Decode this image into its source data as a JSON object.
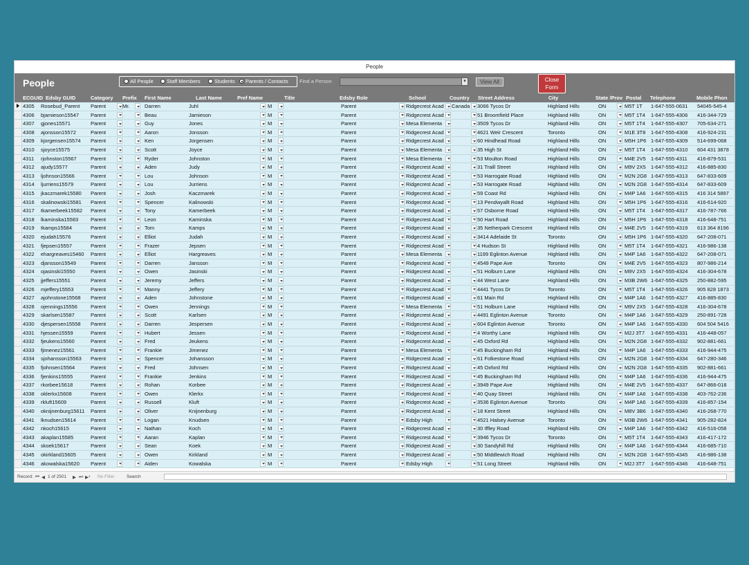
{
  "window": {
    "title": "People"
  },
  "form": {
    "title": "People"
  },
  "filter": {
    "options": [
      {
        "label": "All People",
        "selected": false
      },
      {
        "label": "Staff Members",
        "selected": false
      },
      {
        "label": "Students",
        "selected": false
      },
      {
        "label": "Parents / Contacts",
        "selected": true
      }
    ]
  },
  "find": {
    "label": "Find a Person",
    "value": ""
  },
  "buttons": {
    "view_all": "View All",
    "close_form": "Close Form"
  },
  "columns": [
    "ECGUID",
    "Edsby GUID",
    "Category",
    "Prefix",
    "First Name",
    "Last Name",
    "Pref Name",
    "Title",
    "Edsby Role",
    "School",
    "Country",
    "Street Address",
    "City",
    "State /Prov",
    "Postal",
    "Telephone",
    "Mobile Phon"
  ],
  "rows": [
    {
      "id": "4305",
      "guid": "Rosebud_Parent",
      "cat": "Parent",
      "prefix": "Mr.",
      "first": "Darren",
      "last": "Juhl",
      "g": "M",
      "role": "Parent",
      "school": "Ridgecrest Acad",
      "country": "Canada",
      "street": "3066 Tycos Dr",
      "city": "Highland Hills",
      "prov": "ON",
      "postal": "M5T 1T",
      "tel": "1-647-555-0631",
      "mobile": "54045-545-4"
    },
    {
      "id": "4306",
      "guid": "bjamieson15547",
      "cat": "Parent",
      "prefix": "",
      "first": "Beau",
      "last": "Jamieson",
      "g": "M",
      "role": "Parent",
      "school": "Ridgecrest Acad",
      "country": "",
      "street": "51 Broomfield Place",
      "city": "Highland Hills",
      "prov": "ON",
      "postal": "M5T 1T4",
      "tel": "1-647-555-4306",
      "mobile": "416-344-729"
    },
    {
      "id": "4307",
      "guid": "gjones15571",
      "cat": "Parent",
      "prefix": "",
      "first": "Guy",
      "last": "Jones",
      "g": "M",
      "role": "Parent",
      "school": "Mesa Elementa",
      "country": "",
      "street": "3509 Tycos Dr",
      "city": "Highland Hills",
      "prov": "ON",
      "postal": "M5T 1T4",
      "tel": "1-647-555-4307",
      "mobile": "705-634-271"
    },
    {
      "id": "4308",
      "guid": "ajonsson15572",
      "cat": "Parent",
      "prefix": "",
      "first": "Aaron",
      "last": "Jonsson",
      "g": "M",
      "role": "Parent",
      "school": "Ridgecrest Acad",
      "country": "",
      "street": "4621 Weir Crescent",
      "city": "Toronto",
      "prov": "ON",
      "postal": "M1E 3T8",
      "tel": "1-647-555-4308",
      "mobile": "416-924-231"
    },
    {
      "id": "4309",
      "guid": "kjorgensen15574",
      "cat": "Parent",
      "prefix": "",
      "first": "Ken",
      "last": "Jorgensen",
      "g": "M",
      "role": "Parent",
      "school": "Ridgecrest Acad",
      "country": "",
      "street": "60 Hindhead Road",
      "city": "Highland Hills",
      "prov": "ON",
      "postal": "M5H 1P6",
      "tel": "1-647-555-4309",
      "mobile": "514-699-068"
    },
    {
      "id": "4310",
      "guid": "sjoyce15575",
      "cat": "Parent",
      "prefix": "",
      "first": "Scott",
      "last": "Joyce",
      "g": "M",
      "role": "Parent",
      "school": "Mesa Elementa",
      "country": "",
      "street": "35 High St",
      "city": "Highland Hills",
      "prov": "ON",
      "postal": "M5T 1T4",
      "tel": "1-647-555-4310",
      "mobile": "604 431 3878"
    },
    {
      "id": "4311",
      "guid": "rjohnston15567",
      "cat": "Parent",
      "prefix": "",
      "first": "Ryder",
      "last": "Johnston",
      "g": "M",
      "role": "Parent",
      "school": "Mesa Elementa",
      "country": "",
      "street": "53 Moulton Road",
      "city": "Highland Hills",
      "prov": "ON",
      "postal": "M4E 2V5",
      "tel": "1-647-555-4311",
      "mobile": "416-879-531"
    },
    {
      "id": "4312",
      "guid": "ajudy15577",
      "cat": "Parent",
      "prefix": "",
      "first": "Aden",
      "last": "Judy",
      "g": "M",
      "role": "Parent",
      "school": "Ridgecrest Acad",
      "country": "",
      "street": "31 Traill Street",
      "city": "Highland Hills",
      "prov": "ON",
      "postal": "M9V 2X5",
      "tel": "1-647-555-4312",
      "mobile": "416-885-830"
    },
    {
      "id": "4313",
      "guid": "ljohnson15566",
      "cat": "Parent",
      "prefix": "",
      "first": "Lou",
      "last": "Johnson",
      "g": "M",
      "role": "Parent",
      "school": "Ridgecrest Acad",
      "country": "",
      "street": "53 Harrogate Road",
      "city": "Highland Hills",
      "prov": "ON",
      "postal": "M2N 2G8",
      "tel": "1-647-555-4313",
      "mobile": "647-833-609"
    },
    {
      "id": "4314",
      "guid": "ljurriens15579",
      "cat": "Parent",
      "prefix": "",
      "first": "Lou",
      "last": "Jurriens",
      "g": "M",
      "role": "Parent",
      "school": "Ridgecrest Acad",
      "country": "",
      "street": "53 Harrogate Road",
      "city": "Highland Hills",
      "prov": "ON",
      "postal": "M2N 2G8",
      "tel": "1-647-555-4314",
      "mobile": "647-833-609"
    },
    {
      "id": "4315",
      "guid": "jkaczmarek15580",
      "cat": "Parent",
      "prefix": "",
      "first": "Josh",
      "last": "Kaczmarek",
      "g": "M",
      "role": "Parent",
      "school": "Ridgecrest Acad",
      "country": "",
      "street": "59 Coast Rd",
      "city": "Highland Hills",
      "prov": "ON",
      "postal": "M4P 1A6",
      "tel": "1-647-555-4315",
      "mobile": "416 314 5897"
    },
    {
      "id": "4316",
      "guid": "skalinowski15581",
      "cat": "Parent",
      "prefix": "",
      "first": "Spencer",
      "last": "Kalinowski",
      "g": "M",
      "role": "Parent",
      "school": "Ridgecrest Acad",
      "country": "",
      "street": "13 Pendwyallt Road",
      "city": "Highland Hills",
      "prov": "ON",
      "postal": "M5H 1P6",
      "tel": "1-647-555-4316",
      "mobile": "416-614-920"
    },
    {
      "id": "4317",
      "guid": "tkamerbeek15582",
      "cat": "Parent",
      "prefix": "",
      "first": "Tony",
      "last": "Kamerbeek",
      "g": "M",
      "role": "Parent",
      "school": "Ridgecrest Acad",
      "country": "",
      "street": "57 Osborne Road",
      "city": "Highland Hills",
      "prov": "ON",
      "postal": "M5T 1T4",
      "tel": "1-647-555-4317",
      "mobile": "416-787-766"
    },
    {
      "id": "4318",
      "guid": "lkaminska15583",
      "cat": "Parent",
      "prefix": "",
      "first": "Leon",
      "last": "Kaminska",
      "g": "M",
      "role": "Parent",
      "school": "Ridgecrest Acad",
      "country": "",
      "street": "50 Hart Road",
      "city": "Highland Hills",
      "prov": "ON",
      "postal": "M5H 1P6",
      "tel": "1-647-555-4318",
      "mobile": "416-648-751"
    },
    {
      "id": "4319",
      "guid": "tkamps15584",
      "cat": "Parent",
      "prefix": "",
      "first": "Tom",
      "last": "Kamps",
      "g": "M",
      "role": "Parent",
      "school": "Ridgecrest Acad",
      "country": "",
      "street": "35 Netherpark Crescent",
      "city": "Highland Hills",
      "prov": "ON",
      "postal": "M4E 2V5",
      "tel": "1-647-555-4319",
      "mobile": "613 364 8196"
    },
    {
      "id": "4320",
      "guid": "ejudah15576",
      "cat": "Parent",
      "prefix": "",
      "first": "Elliot",
      "last": "Judah",
      "g": "M",
      "role": "Parent",
      "school": "Ridgecrest Acad",
      "country": "",
      "street": "3414 Adelaide St",
      "city": "Toronto",
      "prov": "ON",
      "postal": "M5H 1P6",
      "tel": "1-647-555-4320",
      "mobile": "647-208-071"
    },
    {
      "id": "4321",
      "guid": "fjepsen15557",
      "cat": "Parent",
      "prefix": "",
      "first": "Frazer",
      "last": "Jepsen",
      "g": "M",
      "role": "Parent",
      "school": "Ridgecrest Acad",
      "country": "",
      "street": "4 Hudson St",
      "city": "Highland Hills",
      "prov": "ON",
      "postal": "M5T 1T4",
      "tel": "1-647-555-4321",
      "mobile": "416-986-138"
    },
    {
      "id": "4322",
      "guid": "ehargreaves15460",
      "cat": "Parent",
      "prefix": "",
      "first": "Elliot",
      "last": "Hargreaves",
      "g": "M",
      "role": "Parent",
      "school": "Mesa Elementa",
      "country": "",
      "street": "1199 Eglinton Avenue",
      "city": "Highland Hills",
      "prov": "ON",
      "postal": "M4P 1A6",
      "tel": "1-647-555-4322",
      "mobile": "647-208-071"
    },
    {
      "id": "4323",
      "guid": "djansson15549",
      "cat": "Parent",
      "prefix": "",
      "first": "Darren",
      "last": "Jansson",
      "g": "M",
      "role": "Parent",
      "school": "Ridgecrest Acad",
      "country": "",
      "street": "4549 Pape Ave",
      "city": "Toronto",
      "prov": "ON",
      "postal": "M4E 2V5",
      "tel": "1-647-555-4323",
      "mobile": "807-986-214"
    },
    {
      "id": "4324",
      "guid": "ojasinski15550",
      "cat": "Parent",
      "prefix": "",
      "first": "Owen",
      "last": "Jasinski",
      "g": "M",
      "role": "Parent",
      "school": "Ridgecrest Acad",
      "country": "",
      "street": "51 Holburn Lane",
      "city": "Highland Hills",
      "prov": "ON",
      "postal": "M9V 2X5",
      "tel": "1-647-555-4324",
      "mobile": "416-304-678"
    },
    {
      "id": "4325",
      "guid": "jjeffers15551",
      "cat": "Parent",
      "prefix": "",
      "first": "Jeremy",
      "last": "Jeffers",
      "g": "M",
      "role": "Parent",
      "school": "Ridgecrest Acad",
      "country": "",
      "street": "44 West Lane",
      "city": "Highland Hills",
      "prov": "ON",
      "postal": "M3B 2W6",
      "tel": "1-647-555-4325",
      "mobile": "250-882-595"
    },
    {
      "id": "4326",
      "guid": "mjeffery15553",
      "cat": "Parent",
      "prefix": "",
      "first": "Manny",
      "last": "Jeffery",
      "g": "M",
      "role": "Parent",
      "school": "Ridgecrest Acad",
      "country": "",
      "street": "4441 Tycos Dr",
      "city": "Toronto",
      "prov": "ON",
      "postal": "M5T 1T4",
      "tel": "1-647-555-4326",
      "mobile": "905 828 1873"
    },
    {
      "id": "4327",
      "guid": "ajohnstone15568",
      "cat": "Parent",
      "prefix": "",
      "first": "Aden",
      "last": "Johnstone",
      "g": "M",
      "role": "Parent",
      "school": "Ridgecrest Acad",
      "country": "",
      "street": "61 Main Rd",
      "city": "Highland Hills",
      "prov": "ON",
      "postal": "M4P 1A6",
      "tel": "1-647-555-4327",
      "mobile": "416-885-830"
    },
    {
      "id": "4328",
      "guid": "ojennings15556",
      "cat": "Parent",
      "prefix": "",
      "first": "Owen",
      "last": "Jennings",
      "g": "M",
      "role": "Parent",
      "school": "Mesa Elementa",
      "country": "",
      "street": "51 Holburn Lane",
      "city": "Highland Hills",
      "prov": "ON",
      "postal": "M9V 2X5",
      "tel": "1-647-555-4328",
      "mobile": "416-304-678"
    },
    {
      "id": "4329",
      "guid": "skarlsen15587",
      "cat": "Parent",
      "prefix": "",
      "first": "Scott",
      "last": "Karlsen",
      "g": "M",
      "role": "Parent",
      "school": "Ridgecrest Acad",
      "country": "",
      "street": "4491 Eglinton Avenue",
      "city": "Toronto",
      "prov": "ON",
      "postal": "M4P 1A6",
      "tel": "1-647-555-4329",
      "mobile": "250-891-728"
    },
    {
      "id": "4330",
      "guid": "djespersen15558",
      "cat": "Parent",
      "prefix": "",
      "first": "Darren",
      "last": "Jespersen",
      "g": "M",
      "role": "Parent",
      "school": "Ridgecrest Acad",
      "country": "",
      "street": "604 Eglinton Avenue",
      "city": "Toronto",
      "prov": "ON",
      "postal": "M4P 1A6",
      "tel": "1-647-555-4330",
      "mobile": "604 504 5416"
    },
    {
      "id": "4331",
      "guid": "hjessen15559",
      "cat": "Parent",
      "prefix": "",
      "first": "Hubert",
      "last": "Jessen",
      "g": "M",
      "role": "Parent",
      "school": "Ridgecrest Acad",
      "country": "",
      "street": "4 Worthy Lane",
      "city": "Highland Hills",
      "prov": "ON",
      "postal": "M2J 3T7",
      "tel": "1-647-555-4331",
      "mobile": "416-448-057"
    },
    {
      "id": "4332",
      "guid": "fjeukens15560",
      "cat": "Parent",
      "prefix": "",
      "first": "Fred",
      "last": "Jeukens",
      "g": "M",
      "role": "Parent",
      "school": "Ridgecrest Acad",
      "country": "",
      "street": "45 Oxford Rd",
      "city": "Highland Hills",
      "prov": "ON",
      "postal": "M2N 2G8",
      "tel": "1-647-555-4332",
      "mobile": "902-881-661"
    },
    {
      "id": "4333",
      "guid": "fjimenez15561",
      "cat": "Parent",
      "prefix": "",
      "first": "Frankie",
      "last": "Jimenez",
      "g": "M",
      "role": "Parent",
      "school": "Mesa Elementa",
      "country": "",
      "street": "45 Buckingham Rd",
      "city": "Highland Hills",
      "prov": "ON",
      "postal": "M4P 1A6",
      "tel": "1-647-555-4333",
      "mobile": "416-944-475"
    },
    {
      "id": "4334",
      "guid": "sjohansson15563",
      "cat": "Parent",
      "prefix": "",
      "first": "Spencer",
      "last": "Johansson",
      "g": "M",
      "role": "Parent",
      "school": "Ridgecrest Acad",
      "country": "",
      "street": "61 Folkestone Road",
      "city": "Highland Hills",
      "prov": "ON",
      "postal": "M2N 2G8",
      "tel": "1-647-555-4334",
      "mobile": "647-280-346"
    },
    {
      "id": "4335",
      "guid": "fjohnsen15564",
      "cat": "Parent",
      "prefix": "",
      "first": "Fred",
      "last": "Johnsen",
      "g": "M",
      "role": "Parent",
      "school": "Ridgecrest Acad",
      "country": "",
      "street": "45 Oxford Rd",
      "city": "Highland Hills",
      "prov": "ON",
      "postal": "M2N 2G8",
      "tel": "1-647-555-4335",
      "mobile": "902-881-661"
    },
    {
      "id": "4336",
      "guid": "fjenkins15555",
      "cat": "Parent",
      "prefix": "",
      "first": "Frankie",
      "last": "Jenkins",
      "g": "M",
      "role": "Parent",
      "school": "Ridgecrest Acad",
      "country": "",
      "street": "45 Buckingham Rd",
      "city": "Highland Hills",
      "prov": "ON",
      "postal": "M4P 1A6",
      "tel": "1-647-555-4336",
      "mobile": "416-944-475"
    },
    {
      "id": "4337",
      "guid": "rkorbee15618",
      "cat": "Parent",
      "prefix": "",
      "first": "Rohan",
      "last": "Korbee",
      "g": "M",
      "role": "Parent",
      "school": "Ridgecrest Acad",
      "country": "",
      "street": "3949 Pape Ave",
      "city": "Highland Hills",
      "prov": "ON",
      "postal": "M4E 2V5",
      "tel": "1-647-555-4337",
      "mobile": "647-866-018"
    },
    {
      "id": "4338",
      "guid": "oklerkx15608",
      "cat": "Parent",
      "prefix": "",
      "first": "Owen",
      "last": "Klerkx",
      "g": "M",
      "role": "Parent",
      "school": "Ridgecrest Acad",
      "country": "",
      "street": "40 Quay Street",
      "city": "Highland Hills",
      "prov": "ON",
      "postal": "M4P 1A6",
      "tel": "1-647-555-4338",
      "mobile": "403-762-236"
    },
    {
      "id": "4339",
      "guid": "rkluft15609",
      "cat": "Parent",
      "prefix": "",
      "first": "Russell",
      "last": "Kluft",
      "g": "M",
      "role": "Parent",
      "school": "Ridgecrest Acad",
      "country": "",
      "street": "3536 Eglinton Avenue",
      "city": "Toronto",
      "prov": "ON",
      "postal": "M4P 1A6",
      "tel": "1-647-555-4339",
      "mobile": "416-857-154"
    },
    {
      "id": "4340",
      "guid": "oknijnenburg15611",
      "cat": "Parent",
      "prefix": "",
      "first": "Oliver",
      "last": "Knijnenburg",
      "g": "M",
      "role": "Parent",
      "school": "Ridgecrest Acad",
      "country": "",
      "street": "18 Kent Street",
      "city": "Highland Hills",
      "prov": "ON",
      "postal": "M8V 3B6",
      "tel": "1-647-555-4340",
      "mobile": "416-268-770"
    },
    {
      "id": "4341",
      "guid": "lknudsen15614",
      "cat": "Parent",
      "prefix": "",
      "first": "Logan",
      "last": "Knudsen",
      "g": "M",
      "role": "Parent",
      "school": "Edsby High",
      "country": "",
      "street": "4521 Halsey Avenue",
      "city": "Toronto",
      "prov": "ON",
      "postal": "M3B 2W6",
      "tel": "1-647-555-4341",
      "mobile": "905-282-824"
    },
    {
      "id": "4342",
      "guid": "nkoch15615",
      "cat": "Parent",
      "prefix": "",
      "first": "Nathan",
      "last": "Koch",
      "g": "M",
      "role": "Parent",
      "school": "Ridgecrest Acad",
      "country": "",
      "street": "30 Iffley Road",
      "city": "Highland Hills",
      "prov": "ON",
      "postal": "M4P 1A6",
      "tel": "1-647-555-4342",
      "mobile": "416-516-058"
    },
    {
      "id": "4343",
      "guid": "akaplan15585",
      "cat": "Parent",
      "prefix": "",
      "first": "Aaran",
      "last": "Kaplan",
      "g": "M",
      "role": "Parent",
      "school": "Ridgecrest Acad",
      "country": "",
      "street": "3946 Tycos Dr",
      "city": "Toronto",
      "prov": "ON",
      "postal": "M5T 1T4",
      "tel": "1-647-555-4343",
      "mobile": "416-417-172"
    },
    {
      "id": "4344",
      "guid": "skoek15617",
      "cat": "Parent",
      "prefix": "",
      "first": "Sean",
      "last": "Koek",
      "g": "M",
      "role": "Parent",
      "school": "Ridgecrest Acad",
      "country": "",
      "street": "30 Sandyhill Rd",
      "city": "Highland Hills",
      "prov": "ON",
      "postal": "M4P 1A6",
      "tel": "1-647-555-4344",
      "mobile": "416-685-710"
    },
    {
      "id": "4345",
      "guid": "okirkland15605",
      "cat": "Parent",
      "prefix": "",
      "first": "Owen",
      "last": "Kirkland",
      "g": "M",
      "role": "Parent",
      "school": "Ridgecrest Acad",
      "country": "",
      "street": "50 Middlewich Road",
      "city": "Highland Hills",
      "prov": "ON",
      "postal": "M2N 2G8",
      "tel": "1-647-555-4345",
      "mobile": "416-986-138"
    },
    {
      "id": "4346",
      "guid": "akowalska15620",
      "cat": "Parent",
      "prefix": "",
      "first": "Aiden",
      "last": "Kowalska",
      "g": "M",
      "role": "Parent",
      "school": "Edsby High",
      "country": "",
      "street": "51 Long Street",
      "city": "Highland Hills",
      "prov": "ON",
      "postal": "M2J 3T7",
      "tel": "1-647-555-4346",
      "mobile": "416-648-751"
    }
  ],
  "nav": {
    "record_label": "Record:",
    "first": "⏮",
    "prev": "◀",
    "position": "1 of 2501",
    "next": "▶",
    "last": "⏭",
    "new": "▶*",
    "no_filter": "No Filter",
    "search": "Search"
  },
  "colors": {
    "row": "#daf0f6",
    "header": "#7a7a7a",
    "close_button": "#c0393b",
    "background": "#2f8197"
  }
}
